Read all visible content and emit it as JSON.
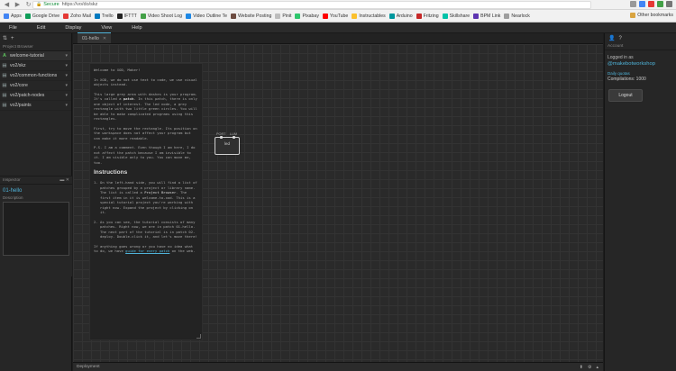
{
  "browser": {
    "secure_label": "Secure",
    "url": "https://vo/do/skz",
    "bookmarks": [
      {
        "label": "Apps",
        "color": "#4285f4"
      },
      {
        "label": "Google Drive",
        "color": "#0f9d58"
      },
      {
        "label": "Zoho Mail",
        "color": "#e53935"
      },
      {
        "label": "Trello",
        "color": "#0079bf"
      },
      {
        "label": "IFTTT",
        "color": "#222222"
      },
      {
        "label": "Video Shoot Log",
        "color": "#43a047"
      },
      {
        "label": "Video Outline Te",
        "color": "#1e88e5"
      },
      {
        "label": "Website Posting",
        "color": "#6d4c41"
      },
      {
        "label": "Pinit",
        "color": "#bdbdbd"
      },
      {
        "label": "Pixabay",
        "color": "#2ec66d"
      },
      {
        "label": "YouTube",
        "color": "#ff0000"
      },
      {
        "label": "Instructables",
        "color": "#fbc02d"
      },
      {
        "label": "Arduino",
        "color": "#00979d"
      },
      {
        "label": "Fritzing",
        "color": "#c62828"
      },
      {
        "label": "Skillshare",
        "color": "#00c2a8"
      },
      {
        "label": "BPM Link",
        "color": "#5e35b1"
      },
      {
        "label": "Nearlock",
        "color": "#9e9e9e"
      }
    ],
    "other_bookmarks": "Other bookmarks"
  },
  "menu": [
    "File",
    "Edit",
    "Display",
    "View",
    "Help"
  ],
  "sidebar": {
    "header": "Project Browser",
    "projects": [
      {
        "label": "welcome-tutorial",
        "icon": "A",
        "active": true
      },
      {
        "label": "vo2/skz",
        "icon": "▤",
        "active": false
      },
      {
        "label": "vo2/common-functions",
        "icon": "▤",
        "active": false
      },
      {
        "label": "vo2/core",
        "icon": "▤",
        "active": false
      },
      {
        "label": "vo2/patch-nodes",
        "icon": "▤",
        "active": false
      },
      {
        "label": "vo2/paints",
        "icon": "▤",
        "active": false
      }
    ]
  },
  "inspector": {
    "header": "Inspector",
    "title": "01-hello",
    "label": "Description"
  },
  "tab": {
    "label": "01-hello"
  },
  "comment": {
    "p1": "Welcome to XOD, Maker!",
    "p2": "In XOD, we do not use text to code, we use visual objects instead.",
    "p3_a": "This large grey area with dashes is your program. It's called a ",
    "p3_b": "patch",
    "p3_c": ". In this patch, there is only one object of interest. The led node, a grey rectangle with two little green circles. You will be able to make complicated programs using this rectangles.",
    "p4": "First, try to move the rectangle. Its position on the workspace does not affect your program but can make it more readable.",
    "p5": "P.S. I am a comment. Even though I am here, I do not affect the patch because I am invisible to it. I am visible only to you. You can move me, too.",
    "heading": "Instructions",
    "li1_num": "1.",
    "li1_a": "On the left-hand side, you will find a list of patches grouped by a project or library name. The list is called a ",
    "li1_b": "Project Browser",
    "li1_c": ". The first item in it is welcome-to-xod. This is a special tutorial project you're working with right now. Expand the project by clicking on it.",
    "li2_num": "2.",
    "li2": "As you can see, the tutorial consists of many patches. Right now, we are in patch 01-hello. The next part of the tutorial is in patch 02-deploy. Double-click it, and let's move there!",
    "p6_a": "If anything goes wrong or you have no idea what to do, we have ",
    "p6_link": "guide for every patch",
    "p6_c": " on the web."
  },
  "node": {
    "title": "led",
    "port1": "PORT",
    "port2": "LUM"
  },
  "bottom": {
    "label": "Deployment"
  },
  "account": {
    "header": "Account",
    "logged_in": "Logged in as",
    "username": "@makebotworkshop",
    "daily_quotas": "Daily quotas",
    "compilations": "Compilations: 1000",
    "logout": "Logout"
  }
}
